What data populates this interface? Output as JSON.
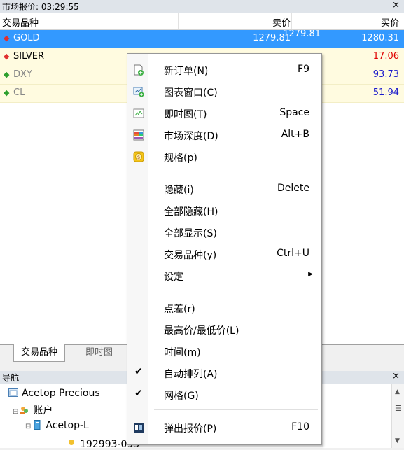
{
  "market_watch": {
    "title": "市场报价: 03:29:55",
    "close": "×",
    "columns": {
      "symbol": "交易品种",
      "bid": "卖价",
      "ask": "买价"
    },
    "rows": [
      {
        "symbol": "GOLD",
        "bid": "1279.81",
        "ask": "1280.31",
        "direction": "down",
        "selected": true
      },
      {
        "symbol": "SILVER",
        "bid": "",
        "ask": "17.06",
        "direction": "down",
        "ask_color": "#e00000"
      },
      {
        "symbol": "DXY",
        "bid": "",
        "ask": "93.73",
        "direction": "up",
        "ask_color": "#1a1acc"
      },
      {
        "symbol": "CL",
        "bid": "",
        "ask": "51.94",
        "direction": "up",
        "ask_color": "#1a1acc"
      }
    ],
    "tabs": [
      "交易品种",
      "即时图"
    ]
  },
  "navigator": {
    "title": "导航",
    "close": "×",
    "items": [
      "Acetop Precious",
      "账户",
      "Acetop-L",
      "192993-093"
    ]
  },
  "context_menu": {
    "items": [
      {
        "label": "新订单(N)",
        "shortcut": "F9",
        "icon": "new-order-icon"
      },
      {
        "label": "图表窗口(C)",
        "shortcut": "",
        "icon": "chart-window-icon"
      },
      {
        "label": "即时图(T)",
        "shortcut": "Space",
        "icon": "tick-chart-icon"
      },
      {
        "label": "市场深度(D)",
        "shortcut": "Alt+B",
        "icon": "depth-of-market-icon"
      },
      {
        "label": "规格(p)",
        "shortcut": "",
        "icon": "specification-icon"
      },
      {
        "label": "隐藏(i)",
        "shortcut": "Delete"
      },
      {
        "label": "全部隐藏(H)",
        "shortcut": ""
      },
      {
        "label": "全部显示(S)",
        "shortcut": ""
      },
      {
        "label": "交易品种(y)",
        "shortcut": "Ctrl+U"
      },
      {
        "label": "设定",
        "shortcut": "",
        "submenu": true
      },
      {
        "label": "点差(r)",
        "shortcut": ""
      },
      {
        "label": "最高价/最低价(L)",
        "shortcut": ""
      },
      {
        "label": "时间(m)",
        "shortcut": ""
      },
      {
        "label": "自动排列(A)",
        "shortcut": "",
        "checked": true
      },
      {
        "label": "网格(G)",
        "shortcut": "",
        "checked": true
      },
      {
        "label": "弹出报价(P)",
        "shortcut": "F10",
        "icon": "popup-prices-icon"
      }
    ]
  },
  "colors": {
    "selection": "#3399ff",
    "row_bg": "#fffbe0",
    "down": "#e03030",
    "up": "#2ea02e"
  }
}
